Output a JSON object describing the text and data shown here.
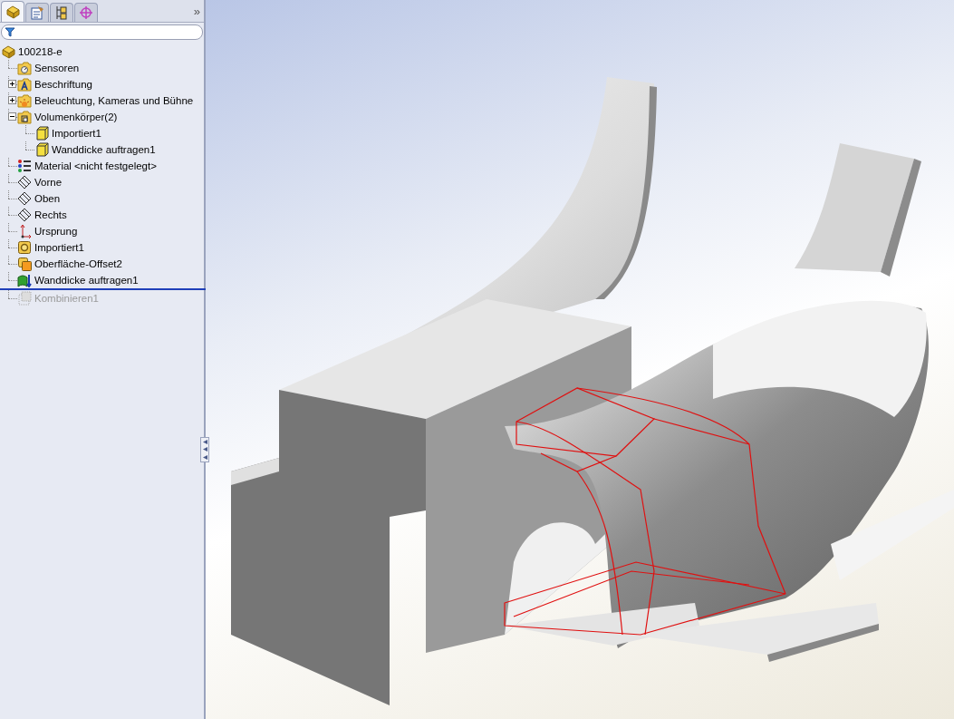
{
  "tabs": [
    {
      "kind": "feature-manager",
      "selected": true
    },
    {
      "kind": "property",
      "selected": false
    },
    {
      "kind": "configuration",
      "selected": false
    },
    {
      "kind": "dimxpert",
      "selected": false
    }
  ],
  "more_tabs": "»",
  "tree": {
    "label": "100218-e",
    "kind": "part",
    "children": [
      {
        "label": "Sensoren",
        "kind": "sensor-folder"
      },
      {
        "label": "Beschriftung",
        "kind": "annotation-folder",
        "expanded": false
      },
      {
        "label": "Beleuchtung, Kameras und Bühne",
        "kind": "lights-folder",
        "expanded": false
      },
      {
        "label": "Volumenkörper(2)",
        "kind": "solid-folder",
        "expanded": true,
        "children": [
          {
            "label": "Importiert1",
            "kind": "solid-body"
          },
          {
            "label": "Wanddicke auftragen1",
            "kind": "solid-body"
          }
        ]
      },
      {
        "label": "Material <nicht festgelegt>",
        "kind": "material"
      },
      {
        "label": "Vorne",
        "kind": "plane"
      },
      {
        "label": "Oben",
        "kind": "plane"
      },
      {
        "label": "Rechts",
        "kind": "plane"
      },
      {
        "label": "Ursprung",
        "kind": "origin"
      },
      {
        "label": "Importiert1",
        "kind": "imported"
      },
      {
        "label": "Oberfläche-Offset2",
        "kind": "offset-surface"
      },
      {
        "label": "Wanddicke auftragen1",
        "kind": "thicken"
      },
      {
        "label": "Kombinieren1",
        "kind": "combine",
        "rolled_back": true
      }
    ]
  }
}
